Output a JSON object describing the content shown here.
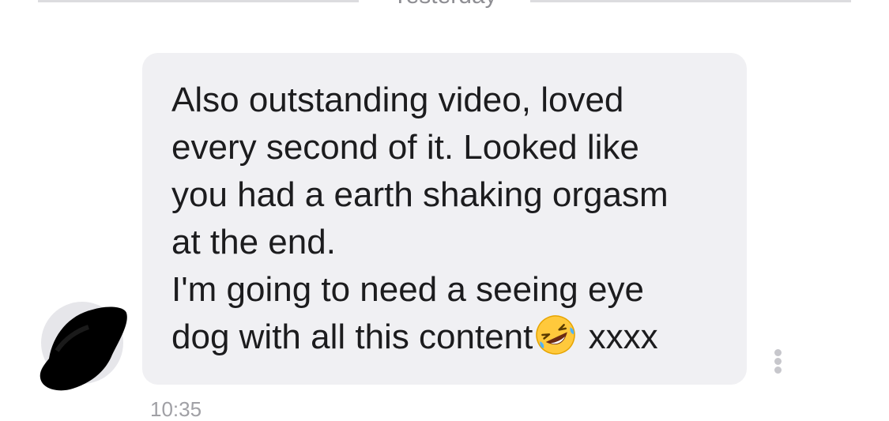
{
  "date_separator": "Yesterday",
  "message": {
    "lines": [
      "Also outstanding video, loved",
      "every second of it. Looked like",
      "you had a earth shaking orgasm",
      "at the end.",
      "I'm going to need a seeing eye"
    ],
    "last_line_before_emoji": "dog with all this content",
    "last_line_after_emoji": " xxxx",
    "emoji": "rolling-on-the-floor-laughing-emoji"
  },
  "timestamp": "10:35",
  "colors": {
    "bubble": "#f0f0f3",
    "text": "#1c1c1e",
    "divider": "#dcdcdf",
    "meta_text": "#8e8e93"
  },
  "icons": {
    "more": "more-vertical-icon"
  }
}
